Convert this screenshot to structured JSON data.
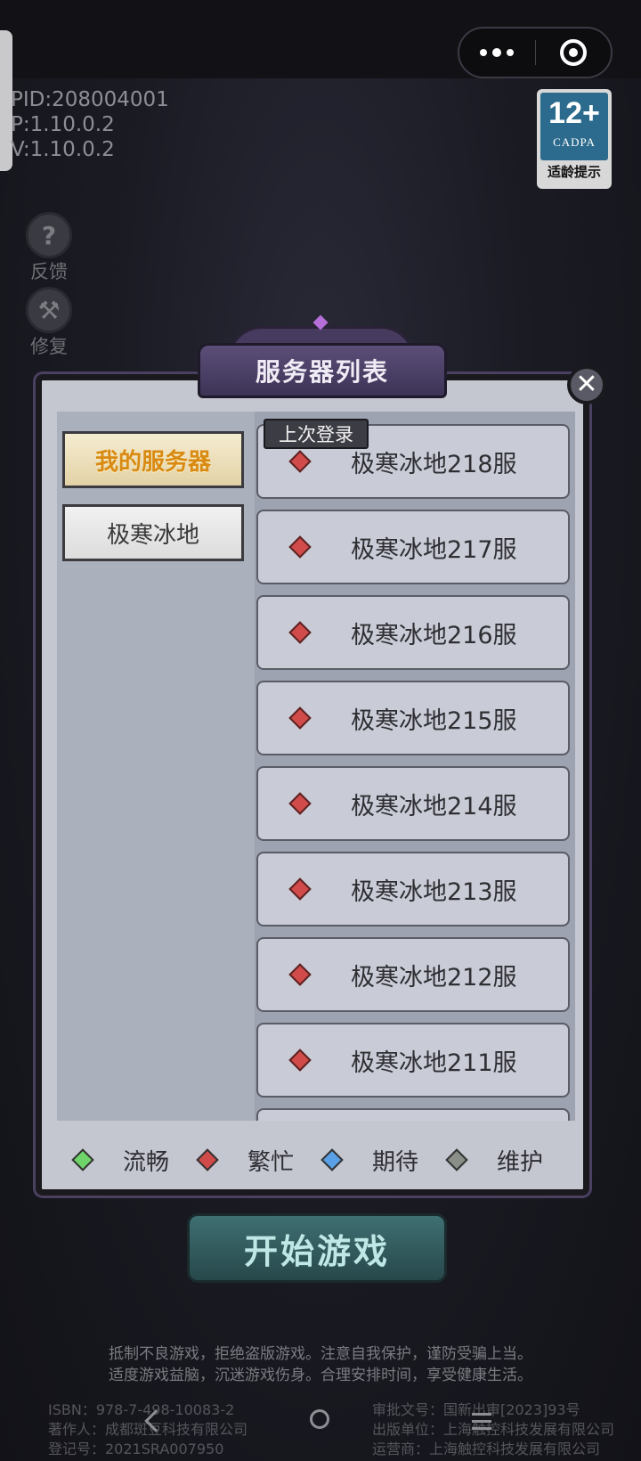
{
  "status": {
    "pid": "PID:208004001",
    "p_version": "P:1.10.0.2",
    "v_version": "V:1.10.0.2"
  },
  "age_rating": {
    "rating": "12+",
    "org": "CADPA",
    "tip": "适龄提示"
  },
  "side_buttons": [
    {
      "icon": "?",
      "label": "反馈"
    },
    {
      "icon": "⚒",
      "label": "修复"
    }
  ],
  "dialog": {
    "title": "服务器列表",
    "close_icon": "✕",
    "categories": [
      {
        "label": "我的服务器",
        "selected": true
      },
      {
        "label": "极寒冰地",
        "selected": false
      }
    ],
    "last_login_tag": "上次登录",
    "servers": [
      {
        "name": "极寒冰地218服",
        "status": "busy"
      },
      {
        "name": "极寒冰地217服",
        "status": "busy"
      },
      {
        "name": "极寒冰地216服",
        "status": "busy"
      },
      {
        "name": "极寒冰地215服",
        "status": "busy"
      },
      {
        "name": "极寒冰地214服",
        "status": "busy"
      },
      {
        "name": "极寒冰地213服",
        "status": "busy"
      },
      {
        "name": "极寒冰地212服",
        "status": "busy"
      },
      {
        "name": "极寒冰地211服",
        "status": "busy"
      }
    ],
    "legend": [
      {
        "label": "流畅",
        "color": "#6fd46a"
      },
      {
        "label": "繁忙",
        "color": "#d24b4b"
      },
      {
        "label": "期待",
        "color": "#5aa0e6"
      },
      {
        "label": "维护",
        "color": "#8a8f88"
      }
    ]
  },
  "start_button": "开始游戏",
  "notice": {
    "line1": "抵制不良游戏，拒绝盗版游戏。注意自我保护，谨防受骗上当。",
    "line2": "适度游戏益脑，沉迷游戏伤身。合理安排时间，享受健康生活。"
  },
  "footer": {
    "isbn": "ISBN：978-7-498-10083-2",
    "author": "著作人：成都斑豆科技有限公司",
    "reg": "登记号：2021SRA007950",
    "approval": "审批文号：国新出审[2023]93号",
    "publisher": "出版单位：上海触控科技发展有限公司",
    "operator": "运营商：上海触控科技发展有限公司"
  }
}
